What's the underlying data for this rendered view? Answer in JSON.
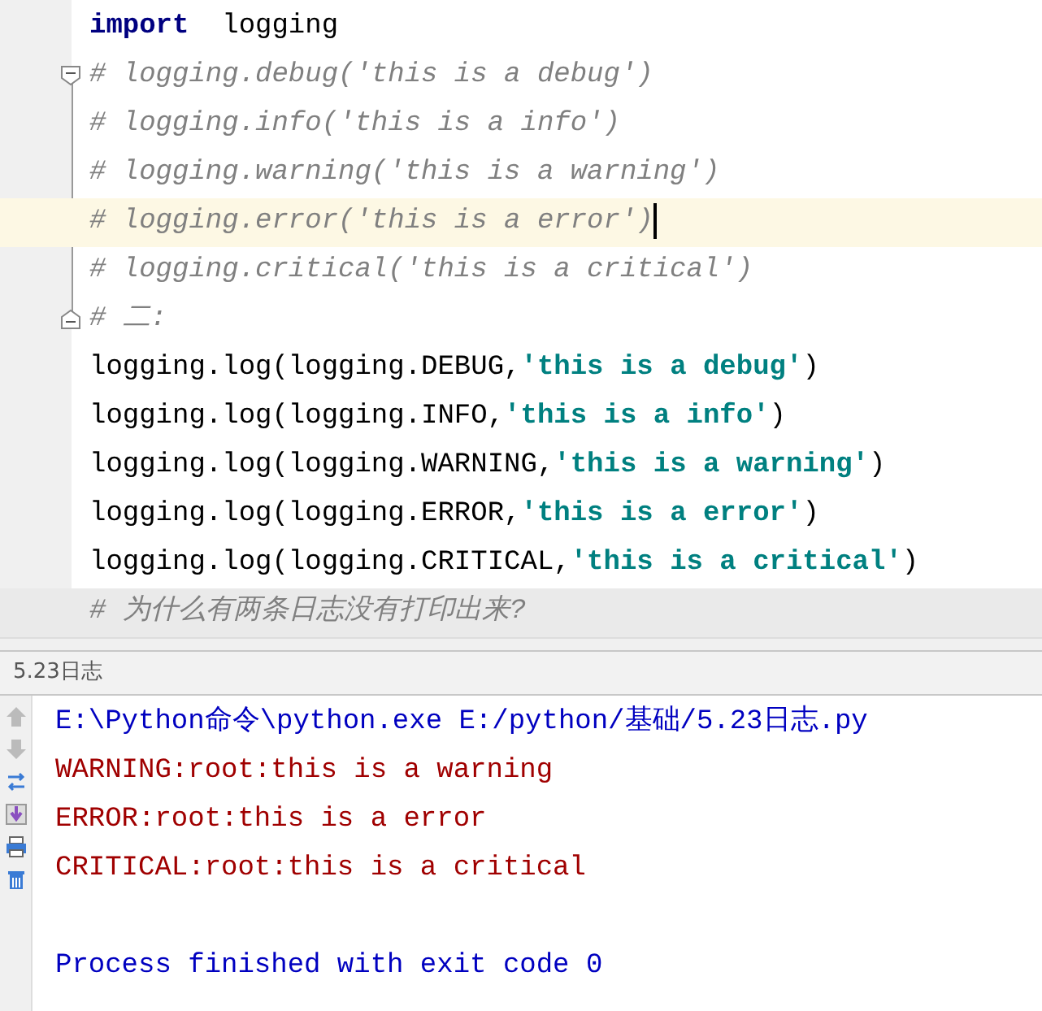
{
  "editor": {
    "lines": [
      {
        "fold_start": false,
        "fold_end": false,
        "current": false,
        "tokens": [
          {
            "kind": "keyword",
            "text": "import"
          },
          {
            "kind": "code",
            "text": "  logging"
          }
        ]
      },
      {
        "fold_start": true,
        "fold_end": false,
        "current": false,
        "tokens": [
          {
            "kind": "comment",
            "text": "# logging.debug('this is a debug')"
          }
        ]
      },
      {
        "fold_start": false,
        "fold_end": false,
        "current": false,
        "tokens": [
          {
            "kind": "comment",
            "text": "# logging.info('this is a info')"
          }
        ]
      },
      {
        "fold_start": false,
        "fold_end": false,
        "current": false,
        "tokens": [
          {
            "kind": "comment",
            "text": "# logging.warning('this is a warning')"
          }
        ]
      },
      {
        "fold_start": false,
        "fold_end": false,
        "current": true,
        "tokens": [
          {
            "kind": "comment",
            "text": "# logging.error('this is a error')"
          }
        ]
      },
      {
        "fold_start": false,
        "fold_end": false,
        "current": false,
        "tokens": [
          {
            "kind": "comment",
            "text": "# logging.critical('this is a critical')"
          }
        ]
      },
      {
        "fold_start": false,
        "fold_end": true,
        "current": false,
        "tokens": [
          {
            "kind": "comment",
            "text": "# 二:"
          }
        ]
      },
      {
        "fold_start": false,
        "fold_end": false,
        "current": false,
        "tokens": [
          {
            "kind": "code",
            "text": "logging.log(logging.DEBUG,"
          },
          {
            "kind": "string",
            "text": "'this is a debug'"
          },
          {
            "kind": "code",
            "text": ")"
          }
        ]
      },
      {
        "fold_start": false,
        "fold_end": false,
        "current": false,
        "tokens": [
          {
            "kind": "code",
            "text": "logging.log(logging.INFO,"
          },
          {
            "kind": "string",
            "text": "'this is a info'"
          },
          {
            "kind": "code",
            "text": ")"
          }
        ]
      },
      {
        "fold_start": false,
        "fold_end": false,
        "current": false,
        "tokens": [
          {
            "kind": "code",
            "text": "logging.log(logging.WARNING,"
          },
          {
            "kind": "string",
            "text": "'this is a warning'"
          },
          {
            "kind": "code",
            "text": ")"
          }
        ]
      },
      {
        "fold_start": false,
        "fold_end": false,
        "current": false,
        "tokens": [
          {
            "kind": "code",
            "text": "logging.log(logging.ERROR,"
          },
          {
            "kind": "string",
            "text": "'this is a error'"
          },
          {
            "kind": "code",
            "text": ")"
          }
        ]
      },
      {
        "fold_start": false,
        "fold_end": false,
        "current": false,
        "tokens": [
          {
            "kind": "code",
            "text": "logging.log(logging.CRITICAL,"
          },
          {
            "kind": "string",
            "text": "'this is a critical'"
          },
          {
            "kind": "code",
            "text": ")"
          }
        ]
      },
      {
        "fold_start": false,
        "fold_end": false,
        "current": false,
        "tokens": [
          {
            "kind": "comment",
            "text": "# 为什么有两条日志没有打印出来?"
          }
        ]
      }
    ]
  },
  "run_tab": {
    "label": "5.23日志"
  },
  "console": {
    "lines": [
      {
        "kind": "command",
        "text": "E:\\Python命令\\python.exe E:/python/基础/5.23日志.py"
      },
      {
        "kind": "stderr",
        "text": "WARNING:root:this is a warning"
      },
      {
        "kind": "stderr",
        "text": "ERROR:root:this is a error"
      },
      {
        "kind": "stderr",
        "text": "CRITICAL:root:this is a critical"
      },
      {
        "kind": "blank"
      },
      {
        "kind": "info",
        "text": "Process finished with exit code 0"
      }
    ]
  }
}
